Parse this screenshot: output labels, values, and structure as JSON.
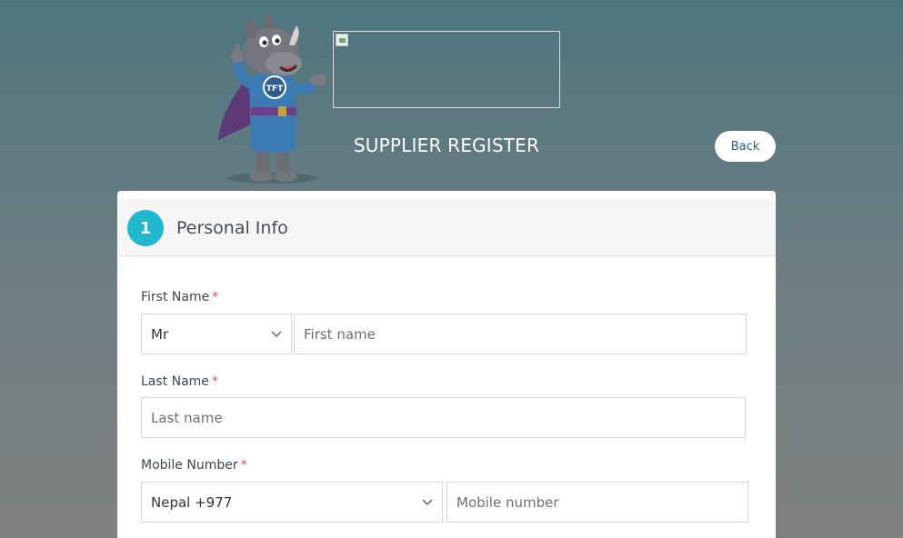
{
  "header": {
    "title": "SUPPLIER REGISTER",
    "back_label": "Back",
    "mascot_badge": "TFT"
  },
  "step": {
    "number": "1",
    "title": "Personal Info"
  },
  "form": {
    "first_name": {
      "label": "First Name",
      "required_mark": "*",
      "title_value": "Mr",
      "placeholder": "First name"
    },
    "last_name": {
      "label": "Last Name",
      "required_mark": "*",
      "placeholder": "Last name"
    },
    "mobile": {
      "label": "Mobile Number",
      "required_mark": "*",
      "country_value": "Nepal +977",
      "placeholder": "Mobile number"
    }
  },
  "colors": {
    "accent": "#1fb8cf",
    "required": "#d9534f",
    "back_text": "#2c5f8f"
  }
}
